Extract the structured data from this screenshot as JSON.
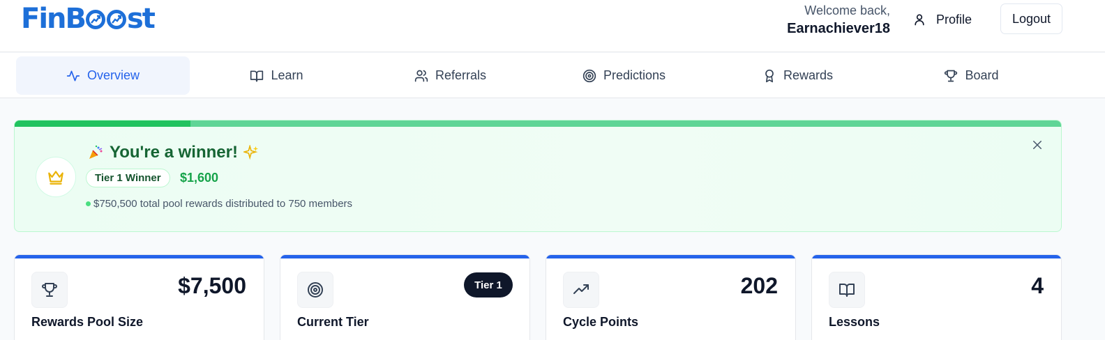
{
  "brand": {
    "name_part1": "FinB",
    "name_part2": "st"
  },
  "header": {
    "welcome": "Welcome back,",
    "username": "Earnachiever18",
    "profile_label": "Profile",
    "logout_label": "Logout"
  },
  "tabs": [
    {
      "label": "Overview",
      "icon": "activity-icon",
      "active": true
    },
    {
      "label": "Learn",
      "icon": "book-icon"
    },
    {
      "label": "Referrals",
      "icon": "users-icon"
    },
    {
      "label": "Predictions",
      "icon": "target-icon"
    },
    {
      "label": "Rewards",
      "icon": "award-icon"
    },
    {
      "label": "Board",
      "icon": "trophy-icon"
    }
  ],
  "banner": {
    "title": "You're a winner!",
    "tier_badge": "Tier 1 Winner",
    "amount": "$1,600",
    "pool_note": "$750,500 total pool rewards distributed to 750 members",
    "progress_fraction": 0.168
  },
  "cards": [
    {
      "label": "Rewards Pool Size",
      "value": "$7,500",
      "icon": "trophy-icon"
    },
    {
      "label": "Current Tier",
      "value": "Tier 1",
      "icon": "target-icon"
    },
    {
      "label": "Cycle Points",
      "value": "202",
      "icon": "trending-up-icon"
    },
    {
      "label": "Lessons",
      "value": "4",
      "icon": "book-icon"
    }
  ],
  "colors": {
    "brand": "#1d6fd8",
    "accent": "#2563eb",
    "success": "#16a34a",
    "success_dark": "#166534",
    "banner_bg": "#ecfdf3"
  }
}
